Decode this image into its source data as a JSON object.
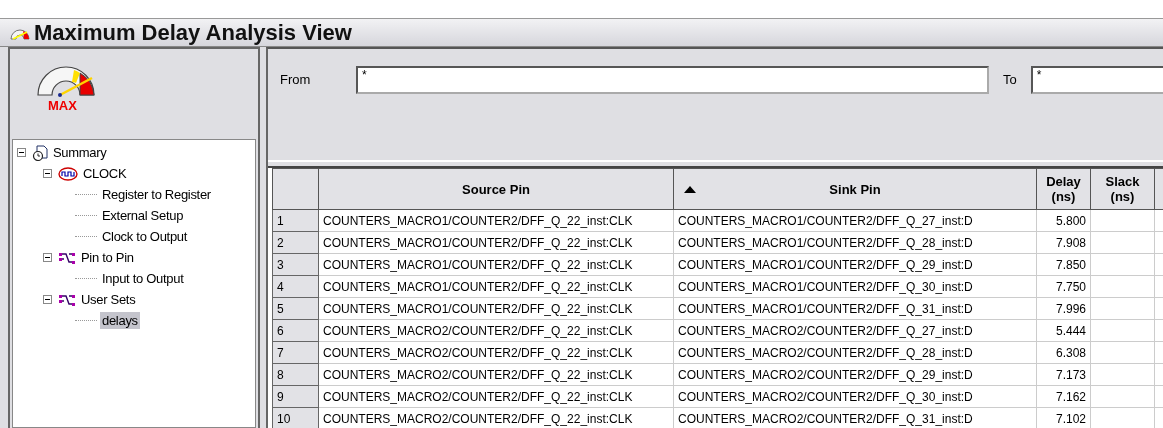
{
  "window": {
    "title": "Maximum Delay Analysis View"
  },
  "logo": {
    "label": "MAX"
  },
  "tree": [
    {
      "label": "Summary",
      "kind": "summary",
      "expanded": true,
      "selected": false,
      "children": [
        {
          "label": "CLOCK",
          "kind": "clock",
          "expanded": true,
          "selected": false,
          "children": [
            {
              "label": "Register to Register",
              "kind": "leaf",
              "selected": false
            },
            {
              "label": "External Setup",
              "kind": "leaf",
              "selected": false
            },
            {
              "label": "Clock to Output",
              "kind": "leaf",
              "selected": false
            }
          ]
        },
        {
          "label": "Pin to Pin",
          "kind": "pins",
          "expanded": true,
          "selected": false,
          "children": [
            {
              "label": "Input to Output",
              "kind": "leaf",
              "selected": false
            }
          ]
        },
        {
          "label": "User Sets",
          "kind": "pins",
          "expanded": true,
          "selected": false,
          "children": [
            {
              "label": "delays",
              "kind": "leaf",
              "selected": true
            }
          ]
        }
      ]
    }
  ],
  "filter": {
    "from_label": "From",
    "from_value": "*",
    "to_label": "To",
    "to_value": "*"
  },
  "table": {
    "columns": [
      {
        "label": "Source Pin",
        "sorted": false
      },
      {
        "label": "Sink Pin",
        "sorted": true
      },
      {
        "label": "Delay (ns)",
        "sorted": false
      },
      {
        "label": "Slack (ns)",
        "sorted": false
      }
    ],
    "rows": [
      {
        "index": "1",
        "source": "COUNTERS_MACRO1/COUNTER2/DFF_Q_22_inst:CLK",
        "sink": "COUNTERS_MACRO1/COUNTER2/DFF_Q_27_inst:D",
        "delay": "5.800"
      },
      {
        "index": "2",
        "source": "COUNTERS_MACRO1/COUNTER2/DFF_Q_22_inst:CLK",
        "sink": "COUNTERS_MACRO1/COUNTER2/DFF_Q_28_inst:D",
        "delay": "7.908"
      },
      {
        "index": "3",
        "source": "COUNTERS_MACRO1/COUNTER2/DFF_Q_22_inst:CLK",
        "sink": "COUNTERS_MACRO1/COUNTER2/DFF_Q_29_inst:D",
        "delay": "7.850"
      },
      {
        "index": "4",
        "source": "COUNTERS_MACRO1/COUNTER2/DFF_Q_22_inst:CLK",
        "sink": "COUNTERS_MACRO1/COUNTER2/DFF_Q_30_inst:D",
        "delay": "7.750"
      },
      {
        "index": "5",
        "source": "COUNTERS_MACRO1/COUNTER2/DFF_Q_22_inst:CLK",
        "sink": "COUNTERS_MACRO1/COUNTER2/DFF_Q_31_inst:D",
        "delay": "7.996"
      },
      {
        "index": "6",
        "source": "COUNTERS_MACRO2/COUNTER2/DFF_Q_22_inst:CLK",
        "sink": "COUNTERS_MACRO2/COUNTER2/DFF_Q_27_inst:D",
        "delay": "5.444"
      },
      {
        "index": "7",
        "source": "COUNTERS_MACRO2/COUNTER2/DFF_Q_22_inst:CLK",
        "sink": "COUNTERS_MACRO2/COUNTER2/DFF_Q_28_inst:D",
        "delay": "6.308"
      },
      {
        "index": "8",
        "source": "COUNTERS_MACRO2/COUNTER2/DFF_Q_22_inst:CLK",
        "sink": "COUNTERS_MACRO2/COUNTER2/DFF_Q_29_inst:D",
        "delay": "7.173"
      },
      {
        "index": "9",
        "source": "COUNTERS_MACRO2/COUNTER2/DFF_Q_22_inst:CLK",
        "sink": "COUNTERS_MACRO2/COUNTER2/DFF_Q_30_inst:D",
        "delay": "7.162"
      },
      {
        "index": "10",
        "source": "COUNTERS_MACRO2/COUNTER2/DFF_Q_22_inst:CLK",
        "sink": "COUNTERS_MACRO2/COUNTER2/DFF_Q_31_inst:D",
        "delay": "7.102"
      }
    ]
  }
}
